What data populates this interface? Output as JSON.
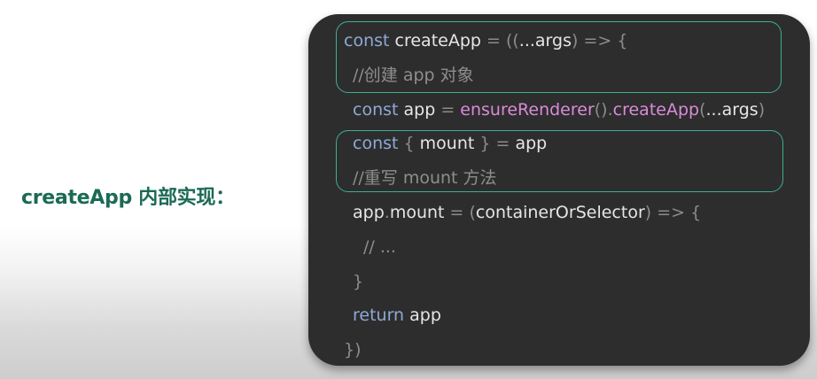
{
  "slide": {
    "label": "createApp 内部实现："
  },
  "colors": {
    "label": "#1b6a55",
    "card_background": "#2d2d2d",
    "highlight_border": "#3fae96",
    "keyword": "#8fa9d6",
    "identifier": "#e6e6e6",
    "function_call": "#d98bd9",
    "comment": "#8e8e8e"
  },
  "code": {
    "line1": {
      "kw": "const",
      "name": "createApp",
      "eq": " = ",
      "open": "((",
      "spread": "...",
      "param": "args",
      "close": ")",
      "arrow": " => {"
    },
    "line2": {
      "comment": "//创建 app 对象"
    },
    "line3": {
      "kw": "const",
      "name": "app",
      "eq": " = ",
      "fn1": "ensureRenderer",
      "parens": "()",
      "dot": ".",
      "fn2": "createApp",
      "open": "(",
      "spread": "...",
      "param": "args",
      "close": ")"
    },
    "line4": {
      "kw": "const",
      "open": "{ ",
      "name": "mount",
      "close": " }",
      "eq": " = ",
      "value": "app"
    },
    "line5": {
      "comment": "//重写 mount 方法"
    },
    "line6": {
      "obj": "app",
      "dot": ".",
      "prop": "mount",
      "eq": " = ",
      "open": "(",
      "param": "containerOrSelector",
      "close": ")",
      "arrow": " => {"
    },
    "line7": {
      "comment": "// ..."
    },
    "line8": {
      "brace": "}"
    },
    "line9": {
      "kw": "return",
      "value": "app"
    },
    "line10": {
      "close": "})"
    }
  }
}
